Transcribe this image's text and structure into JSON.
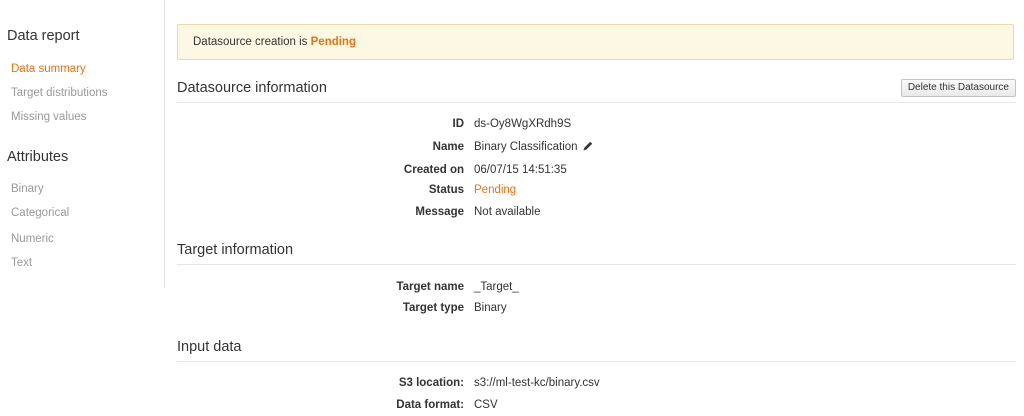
{
  "sidebar": {
    "data_report_heading": "Data report",
    "data_report_links": [
      "Data summary",
      "Target distributions",
      "Missing values"
    ],
    "attributes_heading": "Attributes",
    "attribute_links": [
      "Binary",
      "Categorical",
      "Numeric",
      "Text"
    ]
  },
  "alert": {
    "prefix": "Datasource creation is ",
    "status": "Pending"
  },
  "datasource_info": {
    "title": "Datasource information",
    "delete_label": "Delete this Datasource",
    "rows": [
      {
        "key": "ID",
        "value": "ds-Oy8WgXRdh9S"
      },
      {
        "key": "Name",
        "value": "Binary Classification"
      },
      {
        "key": "Created on",
        "value": "06/07/15 14:51:35"
      },
      {
        "key": "Status",
        "value": "Pending"
      },
      {
        "key": "Message",
        "value": "Not available"
      }
    ]
  },
  "target_info": {
    "title": "Target information",
    "rows": [
      {
        "key": "Target name",
        "value": "_Target_"
      },
      {
        "key": "Target type",
        "value": "Binary"
      }
    ]
  },
  "input_data": {
    "title": "Input data",
    "rows": [
      {
        "key": "S3 location:",
        "value": "s3://ml-test-kc/binary.csv"
      },
      {
        "key": "Data format:",
        "value": "CSV"
      }
    ]
  },
  "colors": {
    "accent": "#ec7211",
    "alert_background": "#fcf8e3"
  },
  "icons": {
    "edit_name": "pencil-icon"
  }
}
